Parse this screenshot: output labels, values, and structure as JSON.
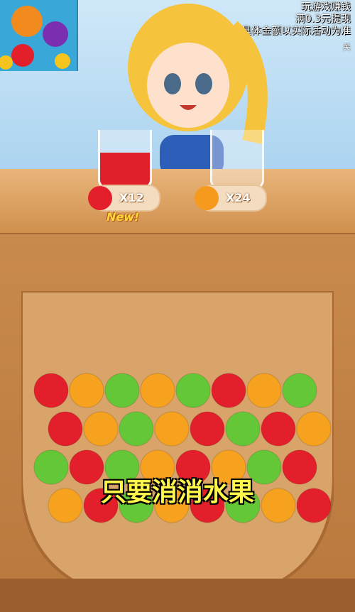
{
  "promo": {
    "line1": "玩游戏赚钱",
    "line2": "满0.3元提现",
    "line3": "具体金额以实际活动为准",
    "close_label": "关"
  },
  "orders": [
    {
      "fruit": "apple",
      "count_label": "X12",
      "color": "#e21f2a"
    },
    {
      "fruit": "orange",
      "count_label": "X24",
      "color": "#f59a1d"
    }
  ],
  "new_tag": "New!",
  "caption": "只要消消水果",
  "colors": {
    "apple": "#e21f2a",
    "orange": "#f7a21f",
    "green_apple": "#64c737",
    "wood_light": "#e8b47a",
    "wood_dark": "#b9783d"
  },
  "fruits_in_bowl": [
    "apple",
    "orange",
    "green_apple",
    "orange",
    "green_apple",
    "apple",
    "orange",
    "green_apple",
    "apple",
    "orange",
    "green_apple",
    "orange",
    "apple",
    "green_apple",
    "apple",
    "orange",
    "green_apple",
    "apple",
    "green_apple",
    "orange",
    "apple",
    "orange",
    "green_apple",
    "apple",
    "orange",
    "apple",
    "green_apple",
    "orange",
    "apple",
    "green_apple",
    "orange",
    "apple"
  ]
}
